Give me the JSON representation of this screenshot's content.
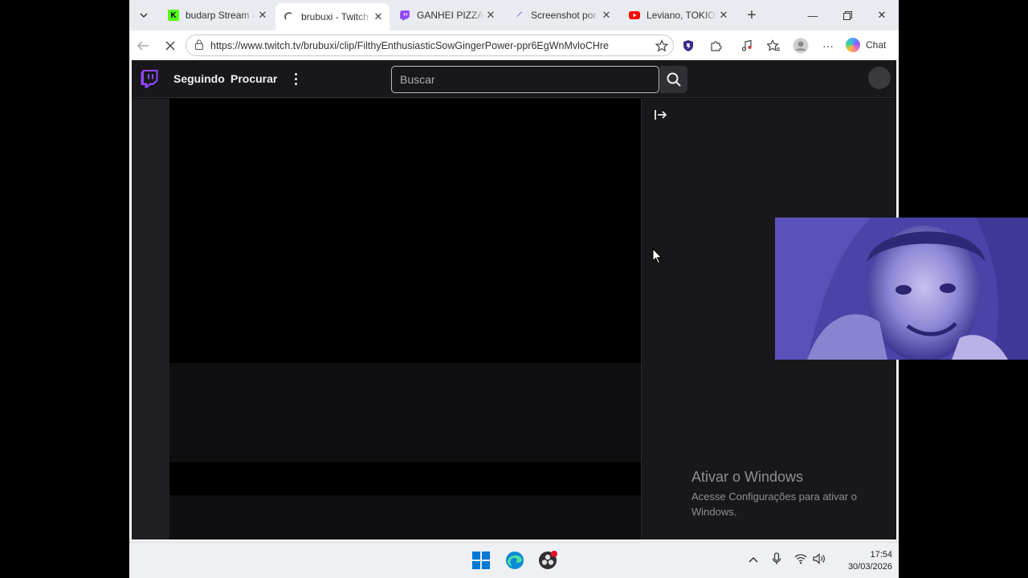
{
  "browser": {
    "tabs": [
      {
        "title": "budarp Stream - W",
        "favicon": "kick-icon",
        "active": false
      },
      {
        "title": "brubuxi - Twitch",
        "favicon": "loading-spinner-icon",
        "active": true
      },
      {
        "title": "GANHEI PIZZA - T",
        "favicon": "twitch-icon",
        "active": false
      },
      {
        "title": "Screenshot por Lig",
        "favicon": "feather-icon",
        "active": false
      },
      {
        "title": "Leviano, TOKIODK",
        "favicon": "youtube-icon",
        "active": false
      }
    ],
    "url": "https://www.twitch.tv/brubuxi/clip/FilthyEnthusiasticSowGingerPower-ppr6EgWnMvloCHre",
    "chat_label": "Chat"
  },
  "twitch": {
    "nav": {
      "following": "Seguindo",
      "browse": "Procurar"
    },
    "search": {
      "placeholder": "Buscar"
    }
  },
  "watermark": {
    "title": "Ativar o Windows",
    "subtitle": "Acesse Configurações para ativar o Windows."
  },
  "taskbar": {
    "time": "17:54",
    "date": "30/03/2026"
  },
  "colors": {
    "twitch_purple": "#9146ff",
    "page_bg": "#0e0e10",
    "nav_bg": "#18181b"
  }
}
